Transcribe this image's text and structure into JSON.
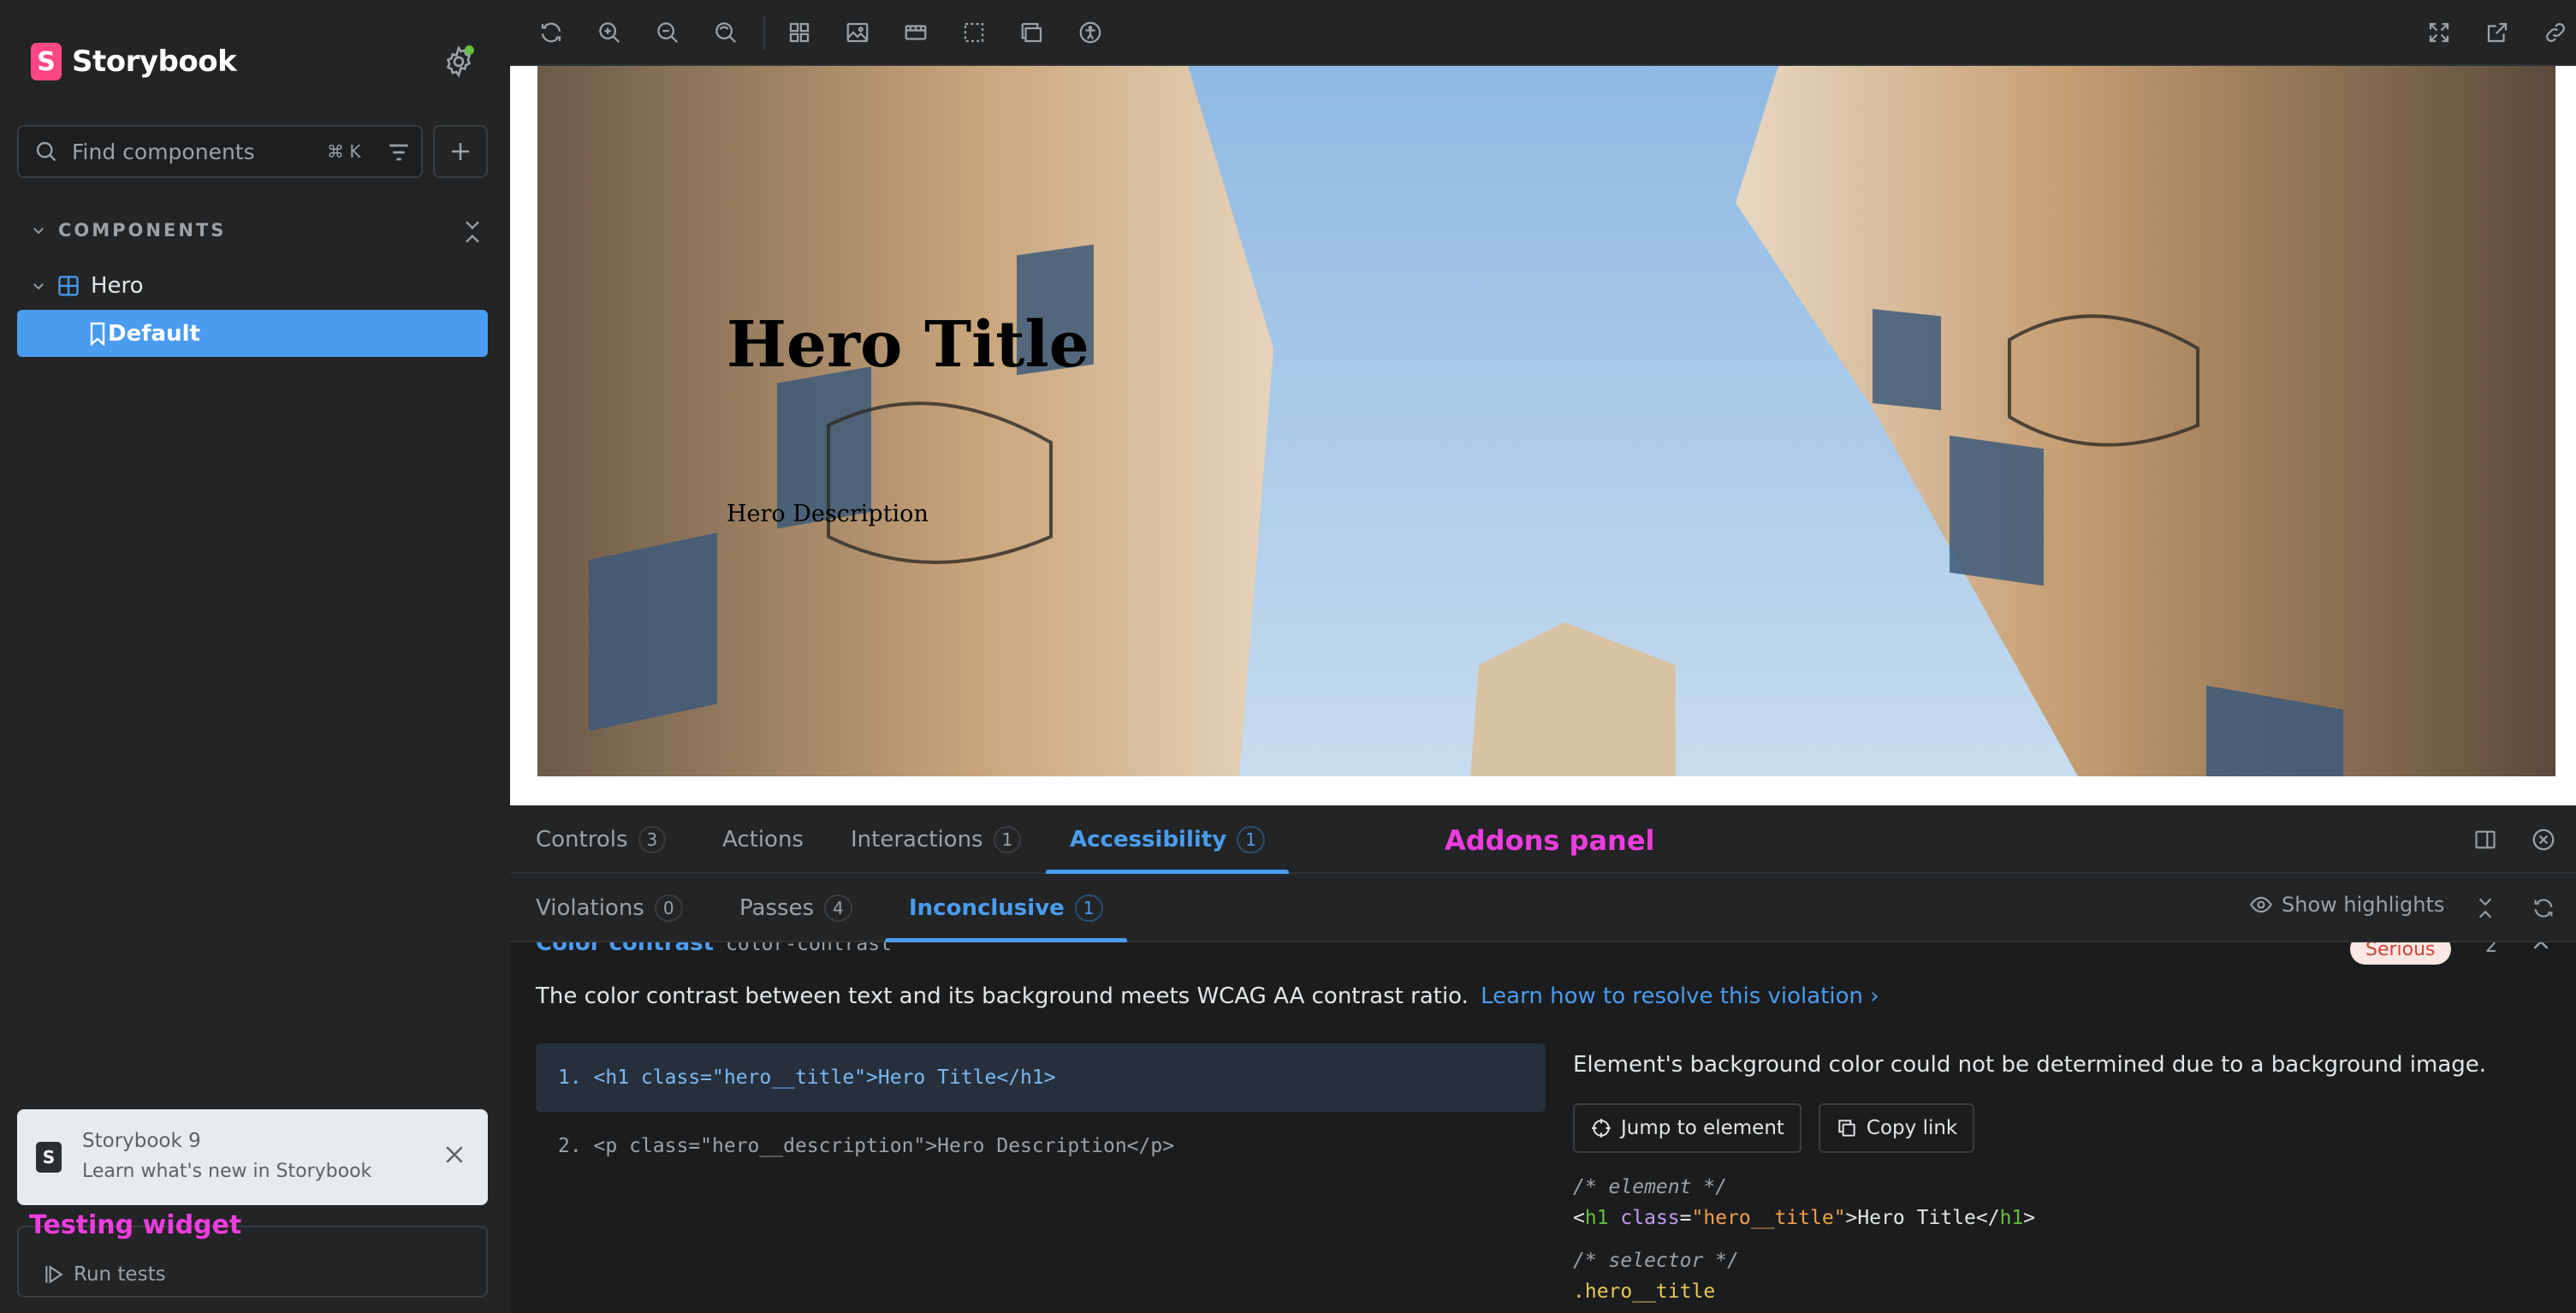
{
  "sidebar": {
    "brand": "Storybook",
    "brand_mark": "S",
    "search_placeholder": "Find components",
    "search_shortcut": "⌘ K",
    "section_label": "COMPONENTS",
    "tree": {
      "component": "Hero",
      "story": "Default"
    },
    "notification": {
      "mark": "S",
      "title": "Storybook 9",
      "subtitle": "Learn what's new in Storybook"
    },
    "testing_widget_label": "Testing widget",
    "run_tests": "Run tests"
  },
  "toolbar": {
    "icons": [
      "reload-icon",
      "zoom-in-icon",
      "zoom-out-icon",
      "zoom-reset-icon",
      "grid-icon",
      "background-icon",
      "viewport-icon",
      "outline-icon",
      "measure-icon",
      "accessibility-icon",
      "fullscreen-icon",
      "open-new-tab-icon",
      "copy-link-icon"
    ]
  },
  "canvas": {
    "hero_title": "Hero Title",
    "hero_description": "Hero Description"
  },
  "panel": {
    "label": "Addons panel",
    "tabs": [
      {
        "label": "Controls",
        "count": "3"
      },
      {
        "label": "Actions",
        "count": ""
      },
      {
        "label": "Interactions",
        "count": "1"
      },
      {
        "label": "Accessibility",
        "count": "1"
      }
    ],
    "subtabs": [
      {
        "label": "Violations",
        "count": "0"
      },
      {
        "label": "Passes",
        "count": "4"
      },
      {
        "label": "Inconclusive",
        "count": "1"
      }
    ],
    "show_highlights": "Show highlights",
    "rule": {
      "name": "Color contrast",
      "id": "color-contrast",
      "severity": "Serious",
      "count": "2",
      "description": "The color contrast between text and its background meets WCAG AA contrast ratio.",
      "link": "Learn how to resolve this violation",
      "nodes": [
        "1. <h1 class=\"hero__title\">Hero Title</h1>",
        "2. <p class=\"hero__description\">Hero Description</p>"
      ],
      "detail_message": "Element's background color could not be determined due to a background image.",
      "jump_button": "Jump to element",
      "copy_button": "Copy link",
      "code_comment_element": "/* element */",
      "code_tag_open": "<",
      "code_tag_name": "h1",
      "code_attr": "class",
      "code_eq": "=",
      "code_value": "\"hero__title\"",
      "code_text": ">Hero Title</",
      "code_tag_close": ">",
      "code_comment_selector": "/* selector */",
      "code_selector": ".hero__title"
    }
  },
  "colors": {
    "accent": "#4a9cf0",
    "brand": "#ff4785",
    "annotation": "#ee3cde",
    "status_green": "#66bf3c"
  }
}
